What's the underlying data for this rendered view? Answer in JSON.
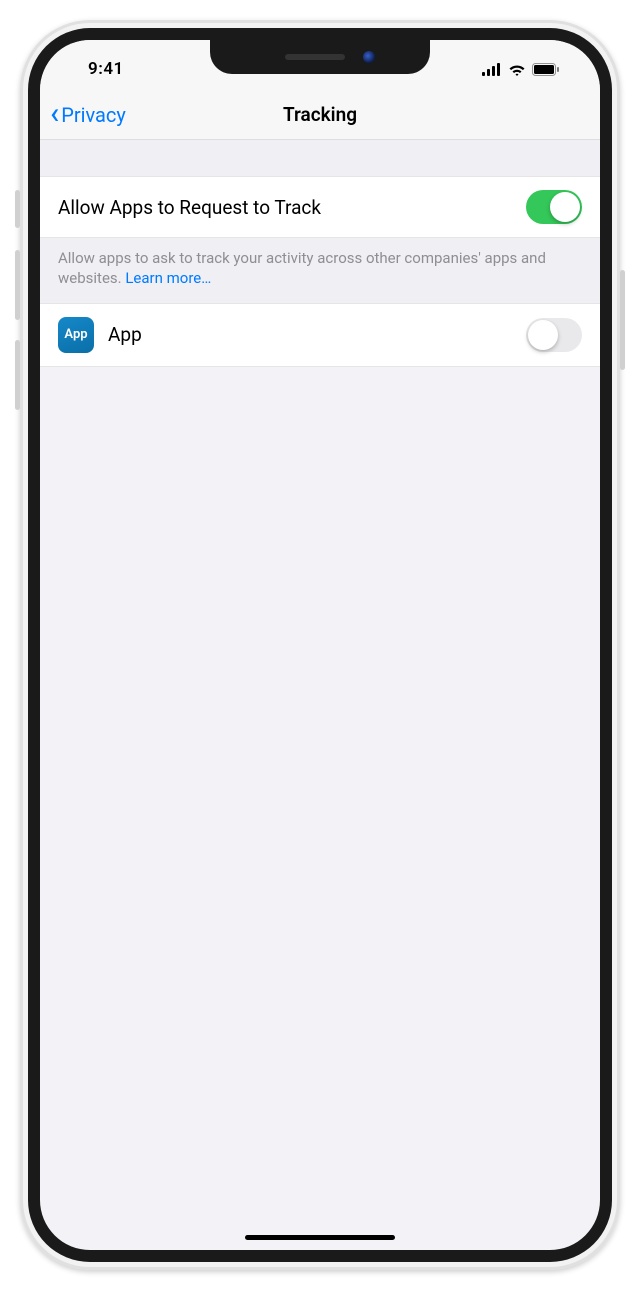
{
  "statusBar": {
    "time": "9:41"
  },
  "nav": {
    "back": "Privacy",
    "title": "Tracking"
  },
  "settings": {
    "allowLabel": "Allow Apps to Request to Track",
    "allowValue": true,
    "footerText": "Allow apps to ask to track your activity across other companies' apps and websites. ",
    "learnMore": "Learn more…"
  },
  "apps": [
    {
      "iconText": "App",
      "name": "App",
      "value": false
    }
  ],
  "colors": {
    "tint": "#007aff",
    "toggleOn": "#34c759"
  }
}
